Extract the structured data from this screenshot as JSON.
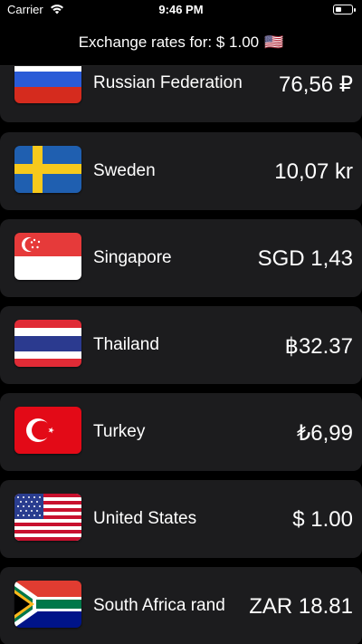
{
  "status_bar": {
    "carrier": "Carrier",
    "time": "9:46 PM"
  },
  "header": {
    "title": "Exchange rates for: $ 1.00",
    "flag": "🇺🇸"
  },
  "rows": [
    {
      "country": "Russian Federation",
      "rate": "76,56 ₽",
      "flag_icon": "russia-flag-icon"
    },
    {
      "country": "Sweden",
      "rate": "10,07 kr",
      "flag_icon": "sweden-flag-icon"
    },
    {
      "country": "Singapore",
      "rate": "SGD 1,43",
      "flag_icon": "singapore-flag-icon"
    },
    {
      "country": "Thailand",
      "rate": "฿32.37",
      "flag_icon": "thailand-flag-icon"
    },
    {
      "country": "Turkey",
      "rate": "₺6,99",
      "flag_icon": "turkey-flag-icon"
    },
    {
      "country": "United States",
      "rate": "$ 1.00",
      "flag_icon": "usa-flag-icon"
    },
    {
      "country": "South Africa rand",
      "rate": "ZAR 18.81",
      "flag_icon": "south-africa-flag-icon"
    }
  ]
}
